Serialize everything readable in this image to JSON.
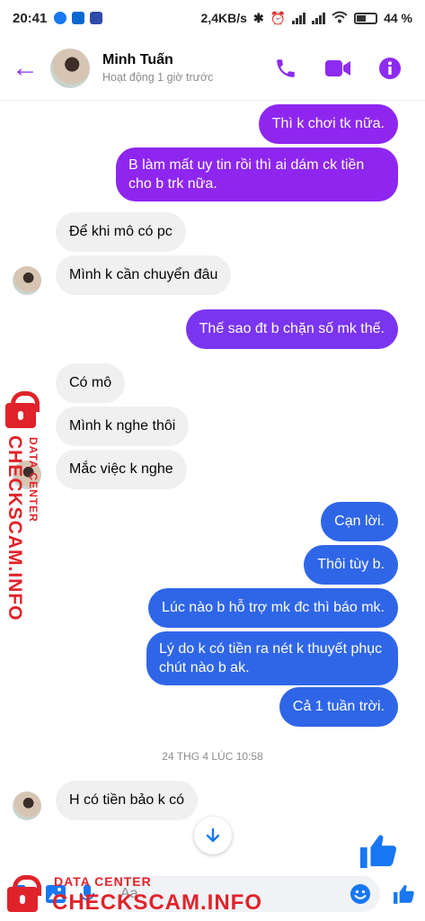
{
  "status_bar": {
    "time": "20:41",
    "speed": "2,4KB/s",
    "battery": "44 %"
  },
  "header": {
    "back_glyph": "←",
    "name": "Minh Tuấn",
    "status": "Hoạt động 1 giờ trước"
  },
  "messages": [
    {
      "text": "Thì k chơi tk nữa.",
      "dir": "out",
      "color": "#8e26f0"
    },
    {
      "text": "B làm mất uy tin rồi thì ai dám ck tiền cho b trk nữa.",
      "dir": "out",
      "color": "#8e26f0"
    },
    {
      "text": "Để khi mô có pc",
      "dir": "in"
    },
    {
      "text": "Mình k cần chuyển đâu",
      "dir": "in"
    },
    {
      "text": "Thế sao đt b chặn số mk thế.",
      "dir": "out",
      "color": "#7a35f0"
    },
    {
      "text": "Có mô",
      "dir": "in"
    },
    {
      "text": "Mình k nghe thôi",
      "dir": "in"
    },
    {
      "text": "Mắc việc k nghe",
      "dir": "in"
    },
    {
      "text": "Cạn lời.",
      "dir": "out",
      "color": "#2f66e8"
    },
    {
      "text": "Thôi tùy b.",
      "dir": "out",
      "color": "#2f66e8"
    },
    {
      "text": "Lúc nào b hỗ trợ mk đc thì báo mk.",
      "dir": "out",
      "color": "#2f66e8"
    },
    {
      "text": "Lý do k có tiền ra nét k thuyết phục chút nào b ak.",
      "dir": "out",
      "color": "#2f66e8"
    },
    {
      "text": "Cả 1 tuần trời.",
      "dir": "out",
      "color": "#2f66e8"
    },
    {
      "text": "H có tiền bảo k có",
      "dir": "in"
    }
  ],
  "timestamp": "24 THG 4 LÚC 10:58",
  "composer": {
    "placeholder": "Aa"
  },
  "watermark": {
    "line1": "DATA CENTER",
    "line2": "CHECKSCAM.INFO"
  },
  "colors": {
    "accent": "#8d2cf0",
    "messenger_blue": "#1877f2",
    "watermark_red": "#e0232a"
  }
}
